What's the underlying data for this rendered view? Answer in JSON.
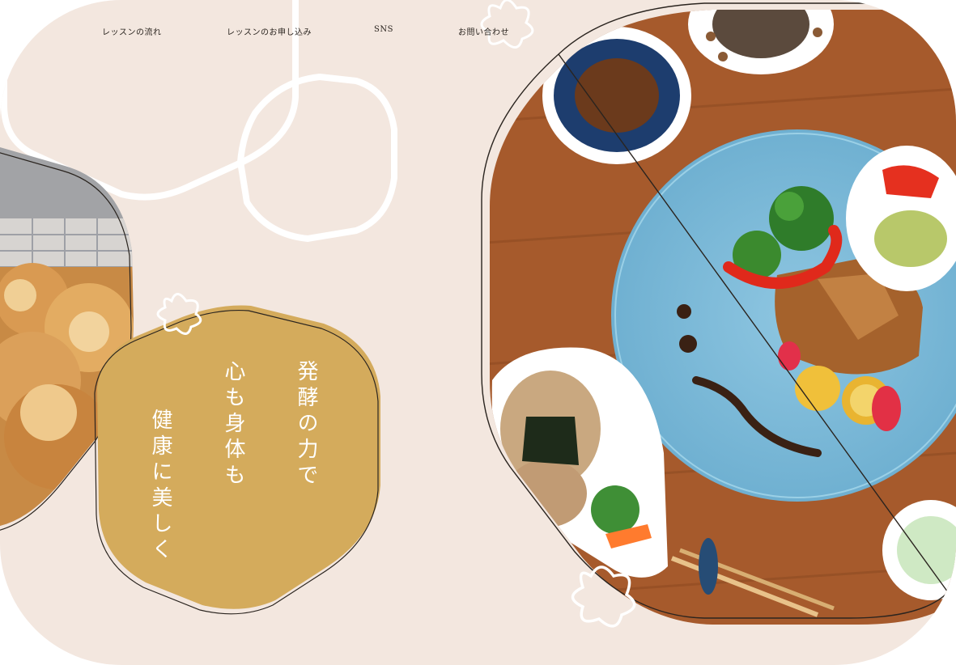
{
  "nav": {
    "items": [
      {
        "label": "レッスンの流れ"
      },
      {
        "label": "レッスンのお申し込み"
      },
      {
        "label": "SNS"
      },
      {
        "label": "お問い合わせ"
      }
    ]
  },
  "hero": {
    "tagline_lines": [
      "発酵の力で",
      "心も身体も",
      "健康に美しく"
    ]
  },
  "colors": {
    "background": "#f3e7df",
    "accent_gold": "#d4ab5c",
    "text": "#2a241f",
    "outline": "#ffffff"
  },
  "images": {
    "left_photo": "pastry-bread-photo",
    "right_photo": "japanese-meal-plate-photo"
  }
}
